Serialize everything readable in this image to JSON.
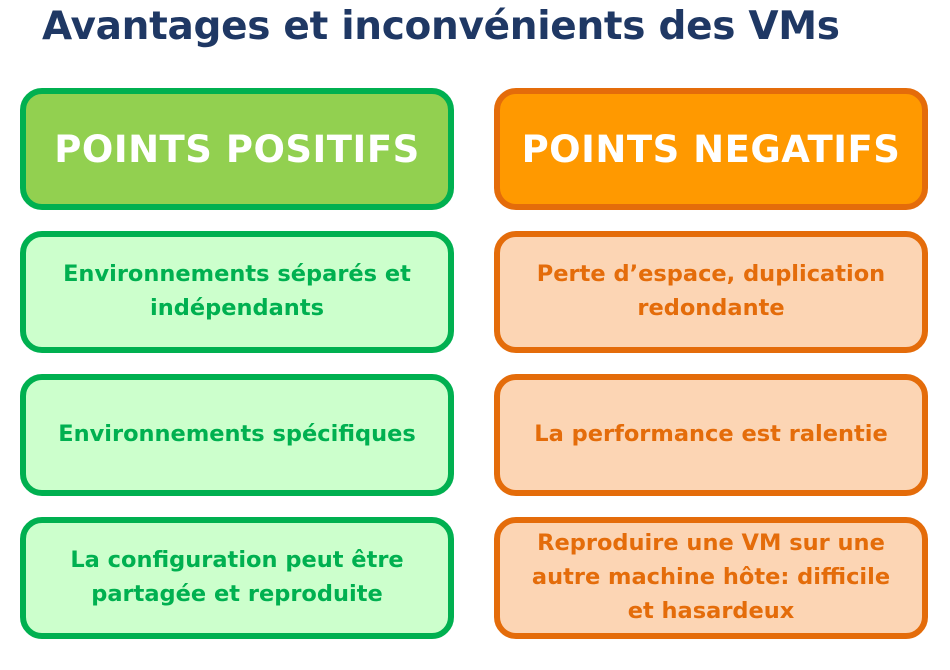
{
  "title": "Avantages et inconvénients des VMs",
  "positive": {
    "header": "POINTS POSITIFS",
    "items": [
      "Environnements séparés et indépendants",
      "Environnements spécifiques",
      "La configuration peut être partagée et reproduite"
    ]
  },
  "negative": {
    "header": "POINTS NEGATIFS",
    "items": [
      "Perte d’espace, duplication redondante",
      "La performance est ralentie",
      "Reproduire une VM sur une autre machine hôte: difficile et hasardeux"
    ]
  },
  "colors": {
    "title": "#1f3864",
    "positive_header_fill": "#92d050",
    "positive_border": "#00b050",
    "positive_item_fill": "#ccffcc",
    "negative_header_fill": "#ff9900",
    "negative_border": "#e46c0a",
    "negative_item_fill": "#fcd5b4"
  }
}
